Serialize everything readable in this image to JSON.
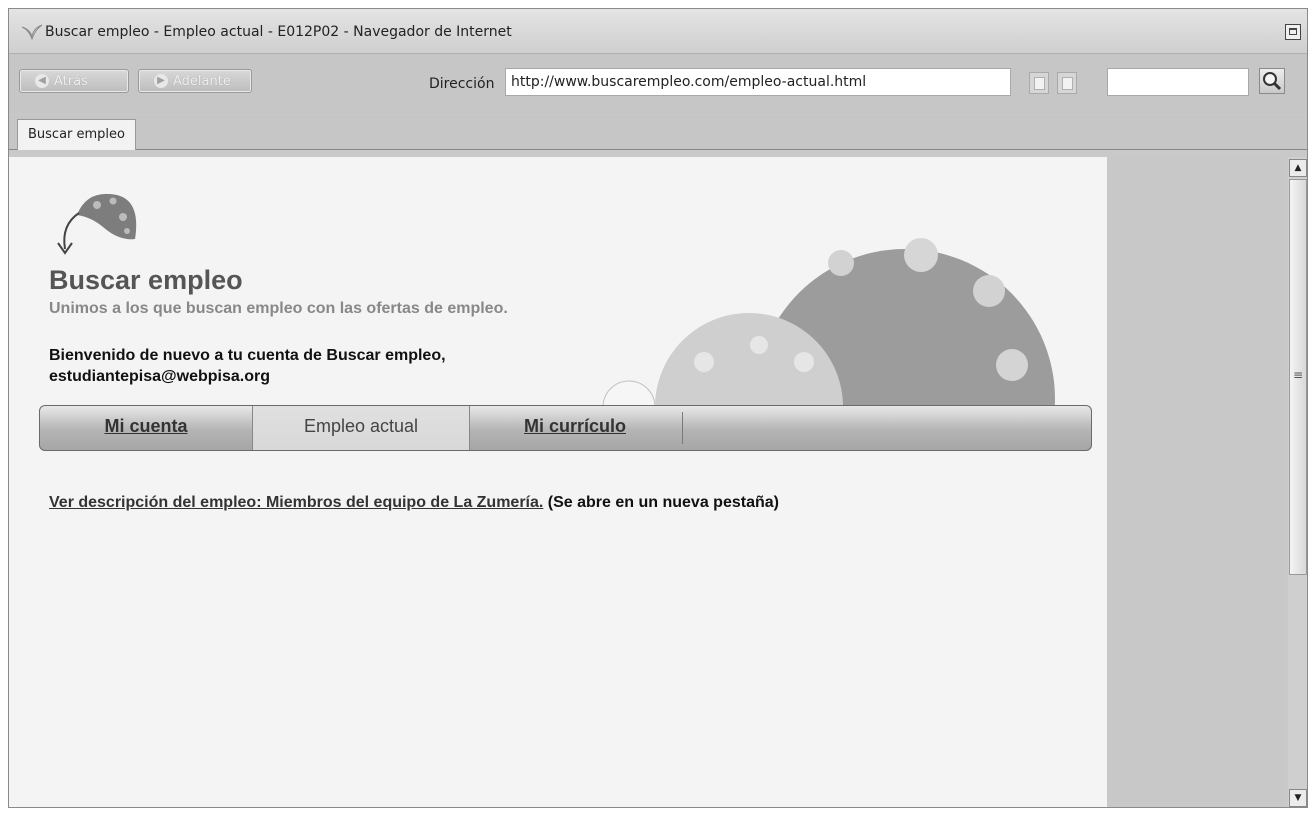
{
  "window": {
    "title": "Buscar empleo - Empleo actual - E012P02 - Navegador de Internet"
  },
  "toolbar": {
    "back_label": "Atrás",
    "forward_label": "Adelante",
    "address_label": "Dirección",
    "address_value": "http://www.buscarempleo.com/empleo-actual.html",
    "search_value": ""
  },
  "tabs": [
    {
      "label": "Buscar empleo"
    }
  ],
  "site": {
    "title": "Buscar empleo",
    "tagline": "Unimos a los que buscan empleo con las ofertas de empleo.",
    "welcome_line1": "Bienvenido de nuevo a tu cuenta de Buscar empleo,",
    "welcome_line2": "estudiantepisa@webpisa.org"
  },
  "nav": {
    "items": [
      {
        "label": "Mi cuenta",
        "active": false
      },
      {
        "label": "Empleo actual",
        "active": true
      },
      {
        "label": "Mi currículo",
        "active": false
      }
    ]
  },
  "main": {
    "job_link_text": "Ver descripción del empleo: Miembros del equipo de La Zumería.",
    "job_link_note": " (Se abre en un nueva pestaña)"
  }
}
